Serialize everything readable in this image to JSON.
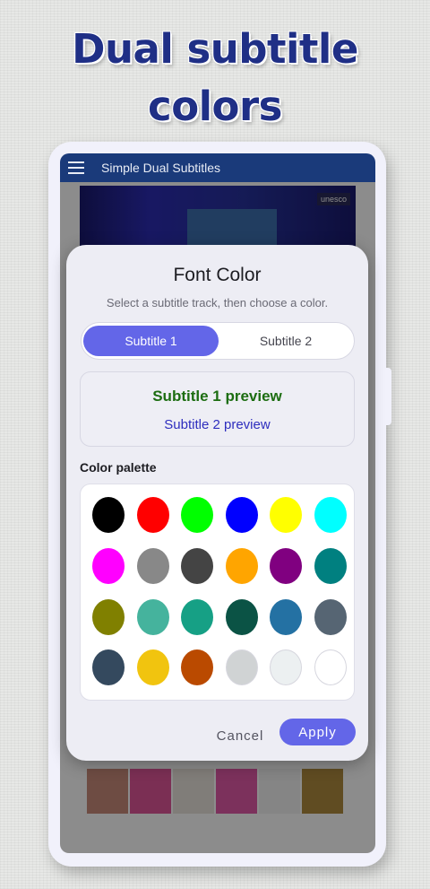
{
  "promo": {
    "line1": "Dual subtitle",
    "line2": "colors"
  },
  "app": {
    "title": "Simple Dual Subtitles",
    "video_logo": "unesco"
  },
  "dialog": {
    "title": "Font Color",
    "subtitle": "Select a subtitle track, then choose a color.",
    "tabs": [
      {
        "label": "Subtitle 1",
        "selected": true
      },
      {
        "label": "Subtitle 2",
        "selected": false
      }
    ],
    "preview": {
      "line1": "Subtitle 1 preview",
      "line1_color": "#1c6d11",
      "line2": "Subtitle 2 preview",
      "line2_color": "#2e2ebe"
    },
    "palette_label": "Color palette",
    "palette": [
      "#000000",
      "#ff0000",
      "#00ff00",
      "#0000ff",
      "#ffff00",
      "#00ffff",
      "#ff00ff",
      "#888888",
      "#444444",
      "#ffa500",
      "#800080",
      "#008080",
      "#808000",
      "#45b39d",
      "#16a085",
      "#0b5345",
      "#2471a3",
      "#566573",
      "#34495e",
      "#f1c40f",
      "#ba4a00",
      "#d0d3d4",
      "#ecf0f1",
      "#ffffff"
    ],
    "cancel_label": "Cancel",
    "apply_label": "Apply"
  },
  "colors": {
    "accent": "#6366e8",
    "appbar": "#1a3a7a",
    "promo_text": "#1f2f86"
  }
}
